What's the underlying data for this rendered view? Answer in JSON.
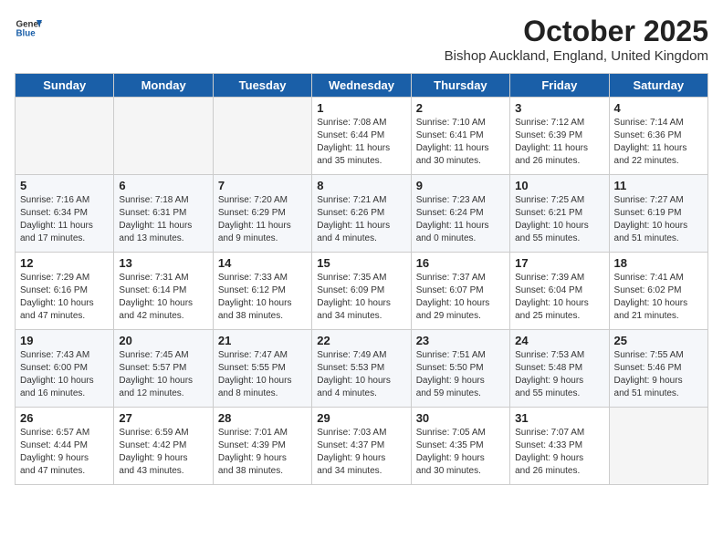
{
  "header": {
    "logo_general": "General",
    "logo_blue": "Blue",
    "month_title": "October 2025",
    "location": "Bishop Auckland, England, United Kingdom"
  },
  "days_of_week": [
    "Sunday",
    "Monday",
    "Tuesday",
    "Wednesday",
    "Thursday",
    "Friday",
    "Saturday"
  ],
  "weeks": [
    [
      {
        "day": "",
        "info": ""
      },
      {
        "day": "",
        "info": ""
      },
      {
        "day": "",
        "info": ""
      },
      {
        "day": "1",
        "info": "Sunrise: 7:08 AM\nSunset: 6:44 PM\nDaylight: 11 hours\nand 35 minutes."
      },
      {
        "day": "2",
        "info": "Sunrise: 7:10 AM\nSunset: 6:41 PM\nDaylight: 11 hours\nand 30 minutes."
      },
      {
        "day": "3",
        "info": "Sunrise: 7:12 AM\nSunset: 6:39 PM\nDaylight: 11 hours\nand 26 minutes."
      },
      {
        "day": "4",
        "info": "Sunrise: 7:14 AM\nSunset: 6:36 PM\nDaylight: 11 hours\nand 22 minutes."
      }
    ],
    [
      {
        "day": "5",
        "info": "Sunrise: 7:16 AM\nSunset: 6:34 PM\nDaylight: 11 hours\nand 17 minutes."
      },
      {
        "day": "6",
        "info": "Sunrise: 7:18 AM\nSunset: 6:31 PM\nDaylight: 11 hours\nand 13 minutes."
      },
      {
        "day": "7",
        "info": "Sunrise: 7:20 AM\nSunset: 6:29 PM\nDaylight: 11 hours\nand 9 minutes."
      },
      {
        "day": "8",
        "info": "Sunrise: 7:21 AM\nSunset: 6:26 PM\nDaylight: 11 hours\nand 4 minutes."
      },
      {
        "day": "9",
        "info": "Sunrise: 7:23 AM\nSunset: 6:24 PM\nDaylight: 11 hours\nand 0 minutes."
      },
      {
        "day": "10",
        "info": "Sunrise: 7:25 AM\nSunset: 6:21 PM\nDaylight: 10 hours\nand 55 minutes."
      },
      {
        "day": "11",
        "info": "Sunrise: 7:27 AM\nSunset: 6:19 PM\nDaylight: 10 hours\nand 51 minutes."
      }
    ],
    [
      {
        "day": "12",
        "info": "Sunrise: 7:29 AM\nSunset: 6:16 PM\nDaylight: 10 hours\nand 47 minutes."
      },
      {
        "day": "13",
        "info": "Sunrise: 7:31 AM\nSunset: 6:14 PM\nDaylight: 10 hours\nand 42 minutes."
      },
      {
        "day": "14",
        "info": "Sunrise: 7:33 AM\nSunset: 6:12 PM\nDaylight: 10 hours\nand 38 minutes."
      },
      {
        "day": "15",
        "info": "Sunrise: 7:35 AM\nSunset: 6:09 PM\nDaylight: 10 hours\nand 34 minutes."
      },
      {
        "day": "16",
        "info": "Sunrise: 7:37 AM\nSunset: 6:07 PM\nDaylight: 10 hours\nand 29 minutes."
      },
      {
        "day": "17",
        "info": "Sunrise: 7:39 AM\nSunset: 6:04 PM\nDaylight: 10 hours\nand 25 minutes."
      },
      {
        "day": "18",
        "info": "Sunrise: 7:41 AM\nSunset: 6:02 PM\nDaylight: 10 hours\nand 21 minutes."
      }
    ],
    [
      {
        "day": "19",
        "info": "Sunrise: 7:43 AM\nSunset: 6:00 PM\nDaylight: 10 hours\nand 16 minutes."
      },
      {
        "day": "20",
        "info": "Sunrise: 7:45 AM\nSunset: 5:57 PM\nDaylight: 10 hours\nand 12 minutes."
      },
      {
        "day": "21",
        "info": "Sunrise: 7:47 AM\nSunset: 5:55 PM\nDaylight: 10 hours\nand 8 minutes."
      },
      {
        "day": "22",
        "info": "Sunrise: 7:49 AM\nSunset: 5:53 PM\nDaylight: 10 hours\nand 4 minutes."
      },
      {
        "day": "23",
        "info": "Sunrise: 7:51 AM\nSunset: 5:50 PM\nDaylight: 9 hours\nand 59 minutes."
      },
      {
        "day": "24",
        "info": "Sunrise: 7:53 AM\nSunset: 5:48 PM\nDaylight: 9 hours\nand 55 minutes."
      },
      {
        "day": "25",
        "info": "Sunrise: 7:55 AM\nSunset: 5:46 PM\nDaylight: 9 hours\nand 51 minutes."
      }
    ],
    [
      {
        "day": "26",
        "info": "Sunrise: 6:57 AM\nSunset: 4:44 PM\nDaylight: 9 hours\nand 47 minutes."
      },
      {
        "day": "27",
        "info": "Sunrise: 6:59 AM\nSunset: 4:42 PM\nDaylight: 9 hours\nand 43 minutes."
      },
      {
        "day": "28",
        "info": "Sunrise: 7:01 AM\nSunset: 4:39 PM\nDaylight: 9 hours\nand 38 minutes."
      },
      {
        "day": "29",
        "info": "Sunrise: 7:03 AM\nSunset: 4:37 PM\nDaylight: 9 hours\nand 34 minutes."
      },
      {
        "day": "30",
        "info": "Sunrise: 7:05 AM\nSunset: 4:35 PM\nDaylight: 9 hours\nand 30 minutes."
      },
      {
        "day": "31",
        "info": "Sunrise: 7:07 AM\nSunset: 4:33 PM\nDaylight: 9 hours\nand 26 minutes."
      },
      {
        "day": "",
        "info": ""
      }
    ]
  ]
}
